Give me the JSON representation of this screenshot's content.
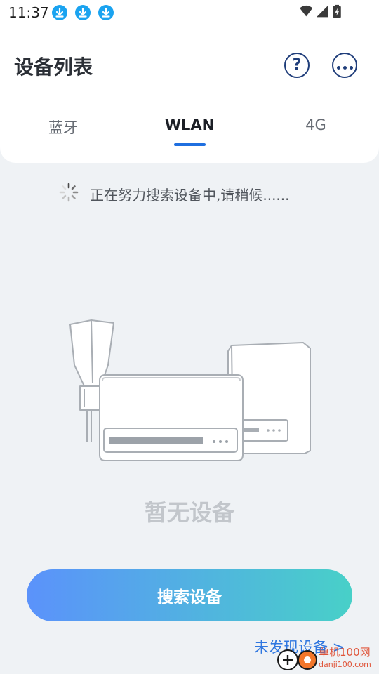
{
  "status_bar": {
    "time": "11:37",
    "notification_icons": [
      "download-icon",
      "download-icon",
      "download-icon"
    ],
    "system_icons": [
      "wifi-icon",
      "signal-icon",
      "battery-charging-icon"
    ]
  },
  "header": {
    "title": "设备列表",
    "help_icon_glyph": "?",
    "more_icon": "more-horizontal-icon"
  },
  "tabs": [
    {
      "label": "蓝牙",
      "selected": false
    },
    {
      "label": "WLAN",
      "selected": true
    },
    {
      "label": "4G",
      "selected": false
    }
  ],
  "searching": {
    "text": "正在努力搜索设备中,请稍候......"
  },
  "empty_state": {
    "text": "暂无设备"
  },
  "actions": {
    "search_button": "搜索设备",
    "not_found_link": "未发现设备 >"
  },
  "watermark": {
    "text": "单机100网",
    "sub": "danji100.com"
  },
  "colors": {
    "accent": "#1f6fe0",
    "icon_dark": "#1f3d7a",
    "gradient_start": "#5b92fb",
    "gradient_end": "#48d0c8",
    "background": "#eff2f5",
    "link": "#2f77e0"
  }
}
